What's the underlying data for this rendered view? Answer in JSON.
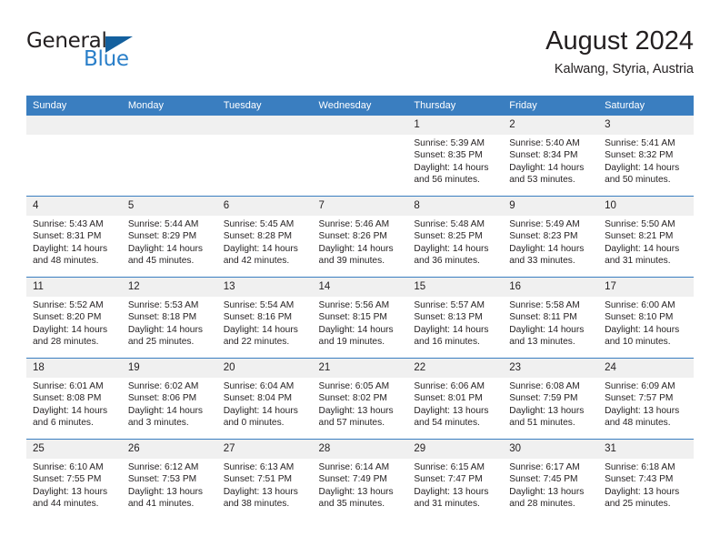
{
  "brand": {
    "name_part1": "General",
    "name_part2": "Blue",
    "triangle_icon": "brand-triangle-icon",
    "colors": {
      "dark": "#231f20",
      "blue": "#2a7fc9",
      "triangle": "#14609e"
    }
  },
  "header": {
    "title": "August 2024",
    "subtitle": "Kalwang, Styria, Austria"
  },
  "calendar": {
    "accent_color": "#3a7ec0",
    "daynum_band_color": "#f0f0f0",
    "weekday_headers": [
      "Sunday",
      "Monday",
      "Tuesday",
      "Wednesday",
      "Thursday",
      "Friday",
      "Saturday"
    ],
    "weeks": [
      [
        {
          "day": "",
          "empty": true,
          "sunrise": "",
          "sunset": "",
          "daylight_line1": "",
          "daylight_line2": ""
        },
        {
          "day": "",
          "empty": true,
          "sunrise": "",
          "sunset": "",
          "daylight_line1": "",
          "daylight_line2": ""
        },
        {
          "day": "",
          "empty": true,
          "sunrise": "",
          "sunset": "",
          "daylight_line1": "",
          "daylight_line2": ""
        },
        {
          "day": "",
          "empty": true,
          "sunrise": "",
          "sunset": "",
          "daylight_line1": "",
          "daylight_line2": ""
        },
        {
          "day": "1",
          "empty": false,
          "sunrise": "Sunrise: 5:39 AM",
          "sunset": "Sunset: 8:35 PM",
          "daylight_line1": "Daylight: 14 hours",
          "daylight_line2": "and 56 minutes."
        },
        {
          "day": "2",
          "empty": false,
          "sunrise": "Sunrise: 5:40 AM",
          "sunset": "Sunset: 8:34 PM",
          "daylight_line1": "Daylight: 14 hours",
          "daylight_line2": "and 53 minutes."
        },
        {
          "day": "3",
          "empty": false,
          "sunrise": "Sunrise: 5:41 AM",
          "sunset": "Sunset: 8:32 PM",
          "daylight_line1": "Daylight: 14 hours",
          "daylight_line2": "and 50 minutes."
        }
      ],
      [
        {
          "day": "4",
          "empty": false,
          "sunrise": "Sunrise: 5:43 AM",
          "sunset": "Sunset: 8:31 PM",
          "daylight_line1": "Daylight: 14 hours",
          "daylight_line2": "and 48 minutes."
        },
        {
          "day": "5",
          "empty": false,
          "sunrise": "Sunrise: 5:44 AM",
          "sunset": "Sunset: 8:29 PM",
          "daylight_line1": "Daylight: 14 hours",
          "daylight_line2": "and 45 minutes."
        },
        {
          "day": "6",
          "empty": false,
          "sunrise": "Sunrise: 5:45 AM",
          "sunset": "Sunset: 8:28 PM",
          "daylight_line1": "Daylight: 14 hours",
          "daylight_line2": "and 42 minutes."
        },
        {
          "day": "7",
          "empty": false,
          "sunrise": "Sunrise: 5:46 AM",
          "sunset": "Sunset: 8:26 PM",
          "daylight_line1": "Daylight: 14 hours",
          "daylight_line2": "and 39 minutes."
        },
        {
          "day": "8",
          "empty": false,
          "sunrise": "Sunrise: 5:48 AM",
          "sunset": "Sunset: 8:25 PM",
          "daylight_line1": "Daylight: 14 hours",
          "daylight_line2": "and 36 minutes."
        },
        {
          "day": "9",
          "empty": false,
          "sunrise": "Sunrise: 5:49 AM",
          "sunset": "Sunset: 8:23 PM",
          "daylight_line1": "Daylight: 14 hours",
          "daylight_line2": "and 33 minutes."
        },
        {
          "day": "10",
          "empty": false,
          "sunrise": "Sunrise: 5:50 AM",
          "sunset": "Sunset: 8:21 PM",
          "daylight_line1": "Daylight: 14 hours",
          "daylight_line2": "and 31 minutes."
        }
      ],
      [
        {
          "day": "11",
          "empty": false,
          "sunrise": "Sunrise: 5:52 AM",
          "sunset": "Sunset: 8:20 PM",
          "daylight_line1": "Daylight: 14 hours",
          "daylight_line2": "and 28 minutes."
        },
        {
          "day": "12",
          "empty": false,
          "sunrise": "Sunrise: 5:53 AM",
          "sunset": "Sunset: 8:18 PM",
          "daylight_line1": "Daylight: 14 hours",
          "daylight_line2": "and 25 minutes."
        },
        {
          "day": "13",
          "empty": false,
          "sunrise": "Sunrise: 5:54 AM",
          "sunset": "Sunset: 8:16 PM",
          "daylight_line1": "Daylight: 14 hours",
          "daylight_line2": "and 22 minutes."
        },
        {
          "day": "14",
          "empty": false,
          "sunrise": "Sunrise: 5:56 AM",
          "sunset": "Sunset: 8:15 PM",
          "daylight_line1": "Daylight: 14 hours",
          "daylight_line2": "and 19 minutes."
        },
        {
          "day": "15",
          "empty": false,
          "sunrise": "Sunrise: 5:57 AM",
          "sunset": "Sunset: 8:13 PM",
          "daylight_line1": "Daylight: 14 hours",
          "daylight_line2": "and 16 minutes."
        },
        {
          "day": "16",
          "empty": false,
          "sunrise": "Sunrise: 5:58 AM",
          "sunset": "Sunset: 8:11 PM",
          "daylight_line1": "Daylight: 14 hours",
          "daylight_line2": "and 13 minutes."
        },
        {
          "day": "17",
          "empty": false,
          "sunrise": "Sunrise: 6:00 AM",
          "sunset": "Sunset: 8:10 PM",
          "daylight_line1": "Daylight: 14 hours",
          "daylight_line2": "and 10 minutes."
        }
      ],
      [
        {
          "day": "18",
          "empty": false,
          "sunrise": "Sunrise: 6:01 AM",
          "sunset": "Sunset: 8:08 PM",
          "daylight_line1": "Daylight: 14 hours",
          "daylight_line2": "and 6 minutes."
        },
        {
          "day": "19",
          "empty": false,
          "sunrise": "Sunrise: 6:02 AM",
          "sunset": "Sunset: 8:06 PM",
          "daylight_line1": "Daylight: 14 hours",
          "daylight_line2": "and 3 minutes."
        },
        {
          "day": "20",
          "empty": false,
          "sunrise": "Sunrise: 6:04 AM",
          "sunset": "Sunset: 8:04 PM",
          "daylight_line1": "Daylight: 14 hours",
          "daylight_line2": "and 0 minutes."
        },
        {
          "day": "21",
          "empty": false,
          "sunrise": "Sunrise: 6:05 AM",
          "sunset": "Sunset: 8:02 PM",
          "daylight_line1": "Daylight: 13 hours",
          "daylight_line2": "and 57 minutes."
        },
        {
          "day": "22",
          "empty": false,
          "sunrise": "Sunrise: 6:06 AM",
          "sunset": "Sunset: 8:01 PM",
          "daylight_line1": "Daylight: 13 hours",
          "daylight_line2": "and 54 minutes."
        },
        {
          "day": "23",
          "empty": false,
          "sunrise": "Sunrise: 6:08 AM",
          "sunset": "Sunset: 7:59 PM",
          "daylight_line1": "Daylight: 13 hours",
          "daylight_line2": "and 51 minutes."
        },
        {
          "day": "24",
          "empty": false,
          "sunrise": "Sunrise: 6:09 AM",
          "sunset": "Sunset: 7:57 PM",
          "daylight_line1": "Daylight: 13 hours",
          "daylight_line2": "and 48 minutes."
        }
      ],
      [
        {
          "day": "25",
          "empty": false,
          "sunrise": "Sunrise: 6:10 AM",
          "sunset": "Sunset: 7:55 PM",
          "daylight_line1": "Daylight: 13 hours",
          "daylight_line2": "and 44 minutes."
        },
        {
          "day": "26",
          "empty": false,
          "sunrise": "Sunrise: 6:12 AM",
          "sunset": "Sunset: 7:53 PM",
          "daylight_line1": "Daylight: 13 hours",
          "daylight_line2": "and 41 minutes."
        },
        {
          "day": "27",
          "empty": false,
          "sunrise": "Sunrise: 6:13 AM",
          "sunset": "Sunset: 7:51 PM",
          "daylight_line1": "Daylight: 13 hours",
          "daylight_line2": "and 38 minutes."
        },
        {
          "day": "28",
          "empty": false,
          "sunrise": "Sunrise: 6:14 AM",
          "sunset": "Sunset: 7:49 PM",
          "daylight_line1": "Daylight: 13 hours",
          "daylight_line2": "and 35 minutes."
        },
        {
          "day": "29",
          "empty": false,
          "sunrise": "Sunrise: 6:15 AM",
          "sunset": "Sunset: 7:47 PM",
          "daylight_line1": "Daylight: 13 hours",
          "daylight_line2": "and 31 minutes."
        },
        {
          "day": "30",
          "empty": false,
          "sunrise": "Sunrise: 6:17 AM",
          "sunset": "Sunset: 7:45 PM",
          "daylight_line1": "Daylight: 13 hours",
          "daylight_line2": "and 28 minutes."
        },
        {
          "day": "31",
          "empty": false,
          "sunrise": "Sunrise: 6:18 AM",
          "sunset": "Sunset: 7:43 PM",
          "daylight_line1": "Daylight: 13 hours",
          "daylight_line2": "and 25 minutes."
        }
      ]
    ]
  }
}
